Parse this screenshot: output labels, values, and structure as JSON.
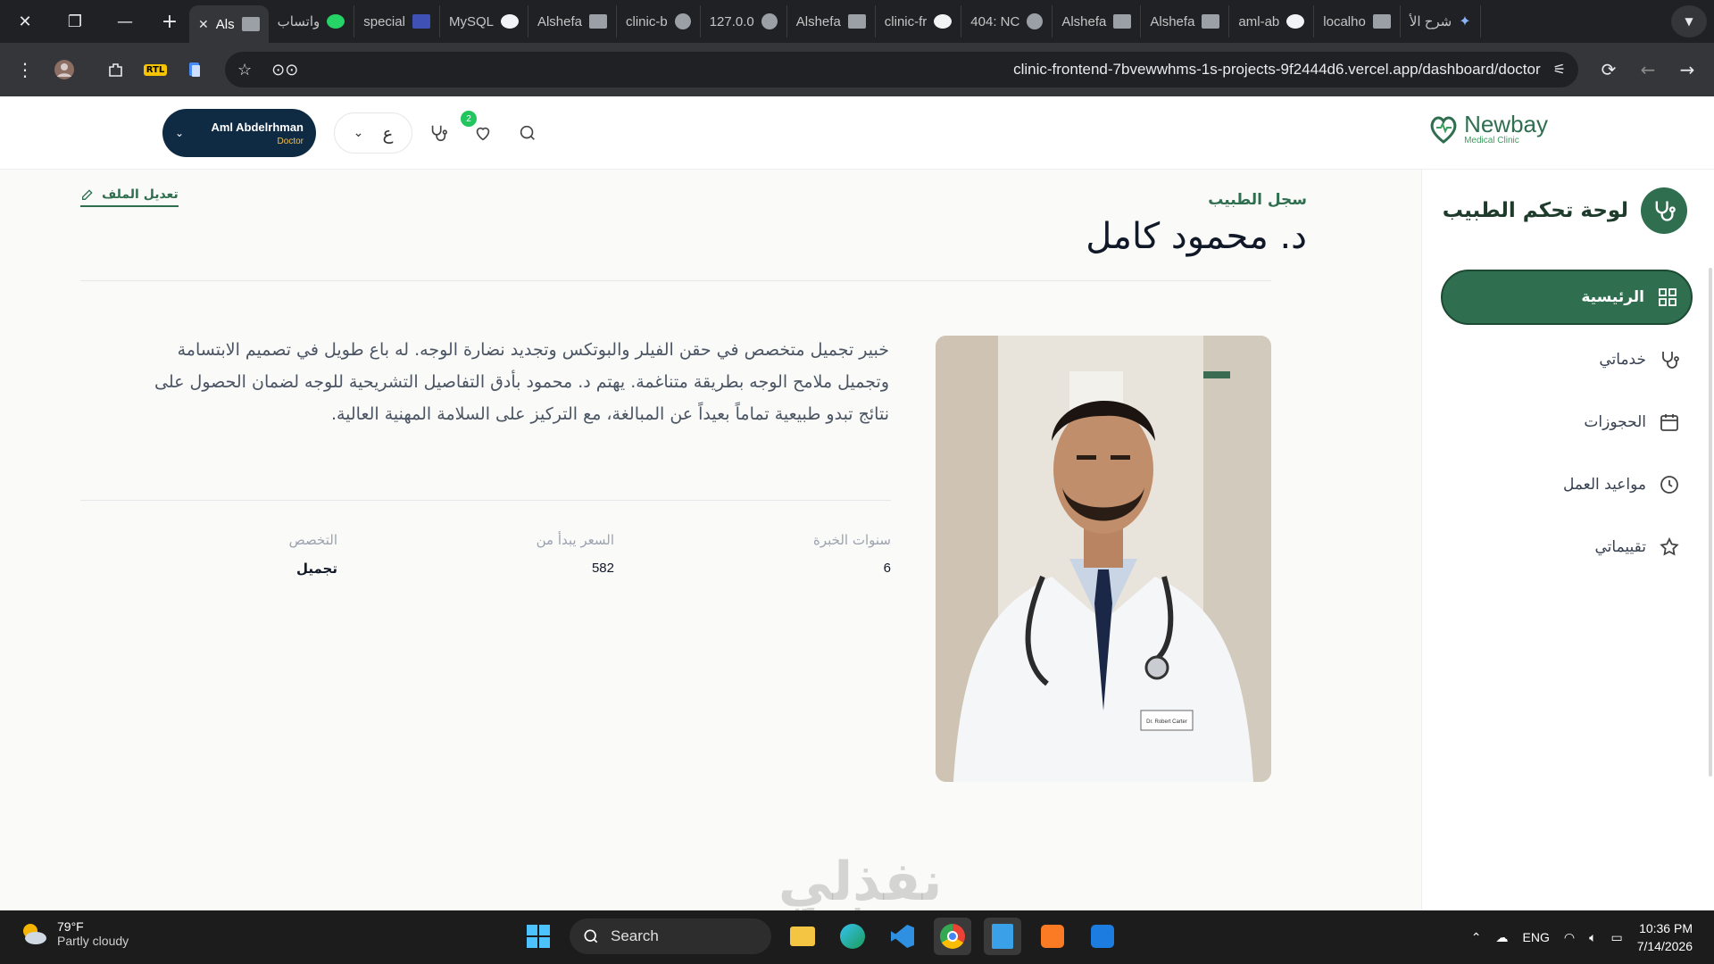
{
  "browser": {
    "tabs": [
      {
        "label": "Als",
        "active": true
      },
      {
        "label": "واتساب"
      },
      {
        "label": "special"
      },
      {
        "label": "MySQL"
      },
      {
        "label": "Alshefa"
      },
      {
        "label": "clinic-b"
      },
      {
        "label": "127.0.0"
      },
      {
        "label": "Alshefa"
      },
      {
        "label": "clinic-fr"
      },
      {
        "label": "404: NC"
      },
      {
        "label": "Alshefa"
      },
      {
        "label": "Alshefa"
      },
      {
        "label": "aml-ab"
      },
      {
        "label": "localho"
      },
      {
        "label": "شرح الأ"
      }
    ],
    "url": "clinic-frontend-7bvewwhms-1s-projects-9f2444d6.vercel.app/dashboard/doctor",
    "ext_rtl": "RTL"
  },
  "header": {
    "logo_name": "Newbay",
    "logo_sub": "Medical Clinic",
    "user_name": "Aml Abdelrhman",
    "user_role": "Doctor",
    "lang": "ع",
    "notif_count": "2"
  },
  "sidebar": {
    "title": "لوحة تحكم الطبيب",
    "items": [
      {
        "label": "الرئيسية",
        "icon": "grid-icon",
        "active": true
      },
      {
        "label": "خدماتي",
        "icon": "stethoscope-icon"
      },
      {
        "label": "الحجوزات",
        "icon": "calendar-icon"
      },
      {
        "label": "مواعيد العمل",
        "icon": "clock-icon"
      },
      {
        "label": "تقييماتي",
        "icon": "star-icon"
      }
    ]
  },
  "profile": {
    "eyebrow": "سجل الطبيب",
    "name": "د. محمود كامل",
    "edit_label": "تعديل الملف",
    "bio": "خبير تجميل متخصص في حقن الفيلر والبوتكس وتجديد نضارة الوجه. له باع طويل في تصميم الابتسامة وتجميل ملامح الوجه بطريقة متناغمة. يهتم د. محمود بأدق التفاصيل التشريحية للوجه لضمان الحصول على نتائج تبدو طبيعية تماماً بعيداً عن المبالغة، مع التركيز على السلامة المهنية العالية.",
    "badge_text": "Dr. Robert Carter",
    "stats": {
      "experience_label": "سنوات الخبرة",
      "experience_value": "6",
      "price_label": "السعر يبدأ من",
      "price_value": "582",
      "specialty_label": "التخصص",
      "specialty_value": "تجميل"
    }
  },
  "watermark": {
    "ar": "نفذلي",
    "en": "nafezly.com"
  },
  "taskbar": {
    "weather_temp": "79°F",
    "weather_desc": "Partly cloudy",
    "search_placeholder": "Search",
    "lang": "ENG",
    "time": "10:36 PM",
    "date": "7/14/2026"
  },
  "colors": {
    "brand": "#2f6f4f",
    "user_pill": "#0f2a43",
    "badge": "#22c55e"
  }
}
